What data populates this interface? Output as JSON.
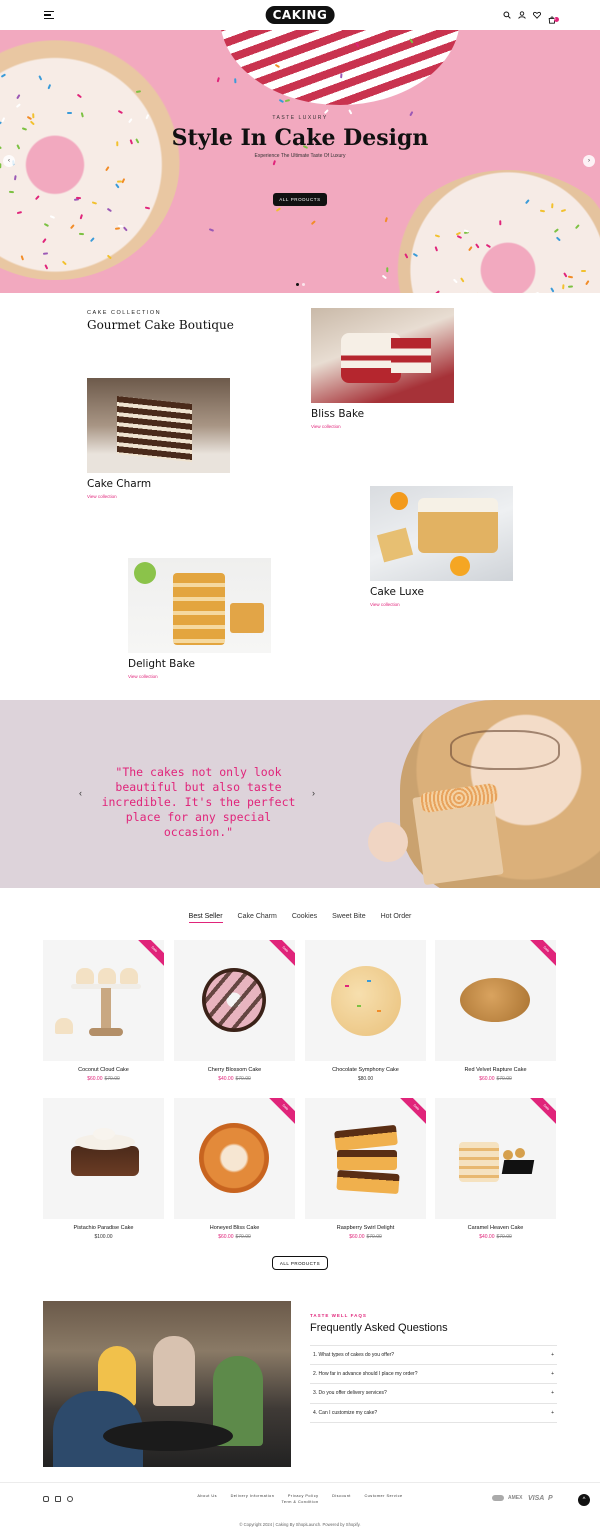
{
  "header": {
    "logo": "CAKING",
    "icons": [
      "menu-icon",
      "search-icon",
      "user-icon",
      "heart-icon",
      "cart-icon"
    ],
    "cart_count": "0"
  },
  "hero": {
    "eyebrow": "TASTE LUXURY",
    "title": "Style In Cake Design",
    "subtitle": "Experience The Ultimate Taste Of Luxury",
    "button": "ALL PRODUCTS",
    "prev": "‹",
    "next": "›",
    "slide_index": 1,
    "slide_count": 2
  },
  "collection": {
    "eyebrow": "CAKE COLLECTION",
    "title": "Gourmet Cake Boutique",
    "items": [
      {
        "name": "Bliss Bake",
        "link": "View collection"
      },
      {
        "name": "Cake Charm",
        "link": "View collection"
      },
      {
        "name": "Cake Luxe",
        "link": "View collection"
      },
      {
        "name": "Delight Bake",
        "link": "View collection"
      }
    ]
  },
  "testimonial": {
    "quote": "\"The cakes not only look beautiful but also taste incredible. It's the perfect place for any special occasion.\"",
    "prev": "‹",
    "next": "›"
  },
  "tabs": [
    "Best Seller",
    "Cake Charm",
    "Cookies",
    "Sweet Bite",
    "Hot Order"
  ],
  "products": [
    {
      "name": "Coconut Cloud Cake",
      "price": "$60.00",
      "compare": "$70.00",
      "sale": "Sale"
    },
    {
      "name": "Cherry Blossom Cake",
      "price": "$40.00",
      "compare": "$70.00",
      "sale": "Sale"
    },
    {
      "name": "Chocolate Symphony Cake",
      "price": "$80.00",
      "compare": "",
      "sale": ""
    },
    {
      "name": "Red Velvet Rapture Cake",
      "price": "$60.00",
      "compare": "$70.00",
      "sale": "Sale"
    },
    {
      "name": "Pistachio Paradise Cake",
      "price": "$100.00",
      "compare": "",
      "sale": ""
    },
    {
      "name": "Honeyed Bliss Cake",
      "price": "$60.00",
      "compare": "$70.00",
      "sale": "Sale"
    },
    {
      "name": "Raspberry Swirl Delight",
      "price": "$60.00",
      "compare": "$70.00",
      "sale": "Sale"
    },
    {
      "name": "Caramel Heaven Cake",
      "price": "$40.00",
      "compare": "$70.00",
      "sale": "Sale"
    }
  ],
  "all_products_button": "ALL PRODUCTS",
  "faq": {
    "eyebrow": "TASTE WELL FAQS",
    "title": "Frequently Asked Questions",
    "items": [
      "1. What types of cakes do you offer?",
      "2. How far in advance should I place my order?",
      "3. Do you offer delivery services?",
      "4. Can I customize my cake?"
    ],
    "toggle": "+"
  },
  "footer": {
    "links": [
      "About Us",
      "Delivery Information",
      "Privacy Policy",
      "Discount",
      "Customer Service",
      "Term & Condition"
    ],
    "social": [
      "instagram-icon",
      "email-icon",
      "pinterest-icon"
    ],
    "payments": [
      "AMEX",
      "VISA",
      "P"
    ],
    "scroll_top": "^",
    "copyright": "© Copyright 2024 | Caking By ShopiLaunch. Powered by Shopify."
  },
  "colors": {
    "accent": "#e0247a",
    "hero_bg": "#f2a9bf",
    "testimonial_bg": "#ddd3da"
  }
}
